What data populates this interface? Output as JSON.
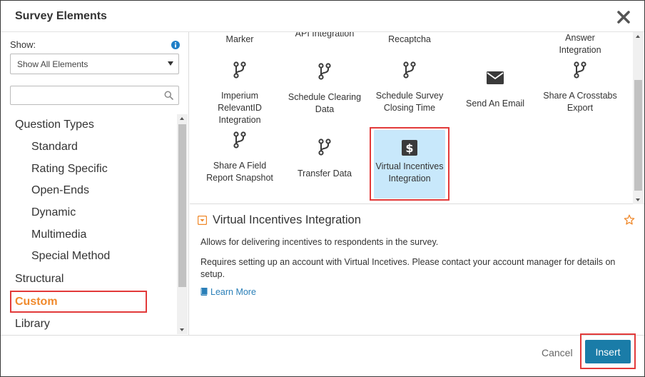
{
  "dialog": {
    "title": "Survey Elements"
  },
  "filter": {
    "show_label": "Show:",
    "select_value": "Show All Elements",
    "search_value": "",
    "search_placeholder": ""
  },
  "tree": {
    "question_types": "Question Types",
    "standard": "Standard",
    "rating_specific": "Rating Specific",
    "open_ends": "Open-Ends",
    "dynamic": "Dynamic",
    "multimedia": "Multimedia",
    "special_method": "Special Method",
    "structural": "Structural",
    "custom": "Custom",
    "library": "Library"
  },
  "grid": {
    "top_row": [
      "Marker",
      "API Integration",
      "Recaptcha",
      "Answer Integration"
    ],
    "row1": [
      {
        "label": "Imperium RelevantID Integration",
        "icon": "branch-icon"
      },
      {
        "label": "Schedule Clearing Data",
        "icon": "branch-icon"
      },
      {
        "label": "Schedule Survey Closing Time",
        "icon": "branch-icon"
      },
      {
        "label": "Send An Email",
        "icon": "envelope-icon"
      },
      {
        "label": "Share A Crosstabs Export",
        "icon": "branch-icon"
      }
    ],
    "row2": [
      {
        "label": "Share A Field Report Snapshot",
        "icon": "branch-icon"
      },
      {
        "label": "Transfer Data",
        "icon": "branch-icon"
      },
      {
        "label": "Virtual Incentives Integration",
        "icon": "dollar-icon",
        "selected": true
      }
    ]
  },
  "detail": {
    "title": "Virtual Incentives Integration",
    "description": "Allows for delivering incentives to respondents in the survey.",
    "requirement": "Requires setting up an account with Virtual Incetives. Please contact your account manager for details on setup.",
    "learn_more": "Learn More"
  },
  "footer": {
    "cancel": "Cancel",
    "insert": "Insert"
  },
  "colors": {
    "accent_orange": "#f0892b",
    "highlight_red": "#e23a3a",
    "insert_blue": "#1a7ca8",
    "selected_bg": "#c8e8fb",
    "link_blue": "#2a7fb8",
    "info_blue": "#1f7fc7"
  }
}
